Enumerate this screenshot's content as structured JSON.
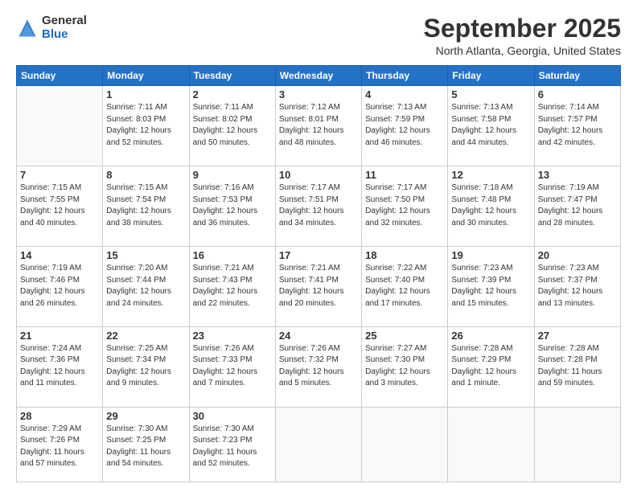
{
  "logo": {
    "general": "General",
    "blue": "Blue"
  },
  "header": {
    "month": "September 2025",
    "location": "North Atlanta, Georgia, United States"
  },
  "days_of_week": [
    "Sunday",
    "Monday",
    "Tuesday",
    "Wednesday",
    "Thursday",
    "Friday",
    "Saturday"
  ],
  "weeks": [
    [
      {
        "day": "",
        "sunrise": "",
        "sunset": "",
        "daylight": ""
      },
      {
        "day": "1",
        "sunrise": "Sunrise: 7:11 AM",
        "sunset": "Sunset: 8:03 PM",
        "daylight": "Daylight: 12 hours and 52 minutes."
      },
      {
        "day": "2",
        "sunrise": "Sunrise: 7:11 AM",
        "sunset": "Sunset: 8:02 PM",
        "daylight": "Daylight: 12 hours and 50 minutes."
      },
      {
        "day": "3",
        "sunrise": "Sunrise: 7:12 AM",
        "sunset": "Sunset: 8:01 PM",
        "daylight": "Daylight: 12 hours and 48 minutes."
      },
      {
        "day": "4",
        "sunrise": "Sunrise: 7:13 AM",
        "sunset": "Sunset: 7:59 PM",
        "daylight": "Daylight: 12 hours and 46 minutes."
      },
      {
        "day": "5",
        "sunrise": "Sunrise: 7:13 AM",
        "sunset": "Sunset: 7:58 PM",
        "daylight": "Daylight: 12 hours and 44 minutes."
      },
      {
        "day": "6",
        "sunrise": "Sunrise: 7:14 AM",
        "sunset": "Sunset: 7:57 PM",
        "daylight": "Daylight: 12 hours and 42 minutes."
      }
    ],
    [
      {
        "day": "7",
        "sunrise": "Sunrise: 7:15 AM",
        "sunset": "Sunset: 7:55 PM",
        "daylight": "Daylight: 12 hours and 40 minutes."
      },
      {
        "day": "8",
        "sunrise": "Sunrise: 7:15 AM",
        "sunset": "Sunset: 7:54 PM",
        "daylight": "Daylight: 12 hours and 38 minutes."
      },
      {
        "day": "9",
        "sunrise": "Sunrise: 7:16 AM",
        "sunset": "Sunset: 7:53 PM",
        "daylight": "Daylight: 12 hours and 36 minutes."
      },
      {
        "day": "10",
        "sunrise": "Sunrise: 7:17 AM",
        "sunset": "Sunset: 7:51 PM",
        "daylight": "Daylight: 12 hours and 34 minutes."
      },
      {
        "day": "11",
        "sunrise": "Sunrise: 7:17 AM",
        "sunset": "Sunset: 7:50 PM",
        "daylight": "Daylight: 12 hours and 32 minutes."
      },
      {
        "day": "12",
        "sunrise": "Sunrise: 7:18 AM",
        "sunset": "Sunset: 7:48 PM",
        "daylight": "Daylight: 12 hours and 30 minutes."
      },
      {
        "day": "13",
        "sunrise": "Sunrise: 7:19 AM",
        "sunset": "Sunset: 7:47 PM",
        "daylight": "Daylight: 12 hours and 28 minutes."
      }
    ],
    [
      {
        "day": "14",
        "sunrise": "Sunrise: 7:19 AM",
        "sunset": "Sunset: 7:46 PM",
        "daylight": "Daylight: 12 hours and 26 minutes."
      },
      {
        "day": "15",
        "sunrise": "Sunrise: 7:20 AM",
        "sunset": "Sunset: 7:44 PM",
        "daylight": "Daylight: 12 hours and 24 minutes."
      },
      {
        "day": "16",
        "sunrise": "Sunrise: 7:21 AM",
        "sunset": "Sunset: 7:43 PM",
        "daylight": "Daylight: 12 hours and 22 minutes."
      },
      {
        "day": "17",
        "sunrise": "Sunrise: 7:21 AM",
        "sunset": "Sunset: 7:41 PM",
        "daylight": "Daylight: 12 hours and 20 minutes."
      },
      {
        "day": "18",
        "sunrise": "Sunrise: 7:22 AM",
        "sunset": "Sunset: 7:40 PM",
        "daylight": "Daylight: 12 hours and 17 minutes."
      },
      {
        "day": "19",
        "sunrise": "Sunrise: 7:23 AM",
        "sunset": "Sunset: 7:39 PM",
        "daylight": "Daylight: 12 hours and 15 minutes."
      },
      {
        "day": "20",
        "sunrise": "Sunrise: 7:23 AM",
        "sunset": "Sunset: 7:37 PM",
        "daylight": "Daylight: 12 hours and 13 minutes."
      }
    ],
    [
      {
        "day": "21",
        "sunrise": "Sunrise: 7:24 AM",
        "sunset": "Sunset: 7:36 PM",
        "daylight": "Daylight: 12 hours and 11 minutes."
      },
      {
        "day": "22",
        "sunrise": "Sunrise: 7:25 AM",
        "sunset": "Sunset: 7:34 PM",
        "daylight": "Daylight: 12 hours and 9 minutes."
      },
      {
        "day": "23",
        "sunrise": "Sunrise: 7:26 AM",
        "sunset": "Sunset: 7:33 PM",
        "daylight": "Daylight: 12 hours and 7 minutes."
      },
      {
        "day": "24",
        "sunrise": "Sunrise: 7:26 AM",
        "sunset": "Sunset: 7:32 PM",
        "daylight": "Daylight: 12 hours and 5 minutes."
      },
      {
        "day": "25",
        "sunrise": "Sunrise: 7:27 AM",
        "sunset": "Sunset: 7:30 PM",
        "daylight": "Daylight: 12 hours and 3 minutes."
      },
      {
        "day": "26",
        "sunrise": "Sunrise: 7:28 AM",
        "sunset": "Sunset: 7:29 PM",
        "daylight": "Daylight: 12 hours and 1 minute."
      },
      {
        "day": "27",
        "sunrise": "Sunrise: 7:28 AM",
        "sunset": "Sunset: 7:28 PM",
        "daylight": "Daylight: 11 hours and 59 minutes."
      }
    ],
    [
      {
        "day": "28",
        "sunrise": "Sunrise: 7:29 AM",
        "sunset": "Sunset: 7:26 PM",
        "daylight": "Daylight: 11 hours and 57 minutes."
      },
      {
        "day": "29",
        "sunrise": "Sunrise: 7:30 AM",
        "sunset": "Sunset: 7:25 PM",
        "daylight": "Daylight: 11 hours and 54 minutes."
      },
      {
        "day": "30",
        "sunrise": "Sunrise: 7:30 AM",
        "sunset": "Sunset: 7:23 PM",
        "daylight": "Daylight: 11 hours and 52 minutes."
      },
      {
        "day": "",
        "sunrise": "",
        "sunset": "",
        "daylight": ""
      },
      {
        "day": "",
        "sunrise": "",
        "sunset": "",
        "daylight": ""
      },
      {
        "day": "",
        "sunrise": "",
        "sunset": "",
        "daylight": ""
      },
      {
        "day": "",
        "sunrise": "",
        "sunset": "",
        "daylight": ""
      }
    ]
  ]
}
